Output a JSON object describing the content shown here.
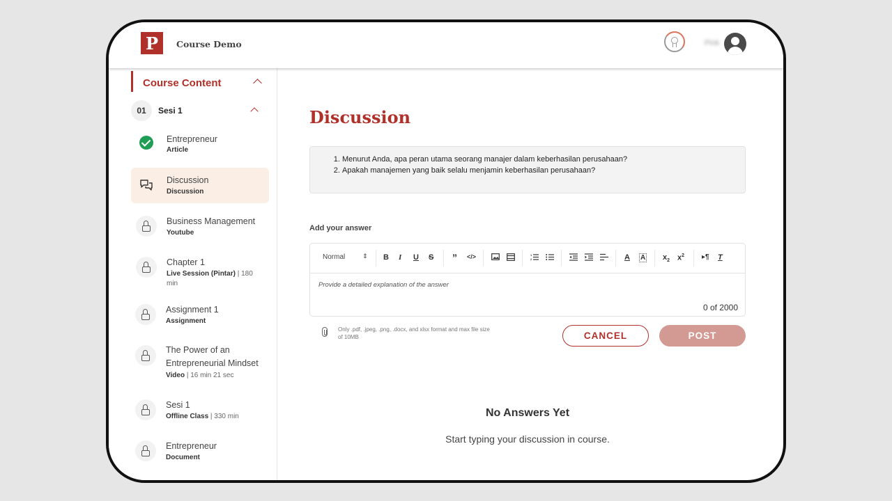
{
  "header": {
    "logo_text": "P",
    "app_title": "Course Demo",
    "username": "Pink"
  },
  "sidebar": {
    "section_title": "Course Content",
    "session": {
      "number": "01",
      "name": "Sesi 1"
    },
    "items": [
      {
        "title": "Entrepreneur",
        "type": "Article",
        "extra": ""
      },
      {
        "title": "Discussion",
        "type": "Discussion",
        "extra": ""
      },
      {
        "title": "Business Management",
        "type": "Youtube",
        "extra": ""
      },
      {
        "title": "Chapter 1",
        "type": "Live Session (Pintar)",
        "extra": " | 180 min"
      },
      {
        "title": "Assignment 1",
        "type": "Assignment",
        "extra": ""
      },
      {
        "title": "The Power of an Entrepreneurial Mindset",
        "type": "Video",
        "extra": " | 16 min 21 sec"
      },
      {
        "title": "Sesi 1",
        "type": "Offline Class",
        "extra": " | 330 min"
      },
      {
        "title": "Entrepreneur",
        "type": "Document",
        "extra": ""
      }
    ]
  },
  "main": {
    "title": "Discussion",
    "questions": [
      "Menurut Anda, apa peran utama seorang manajer dalam keberhasilan perusahaan?",
      "Apakah manajemen yang baik selalu menjamin keberhasilan perusahaan?"
    ],
    "answer_label": "Add your answer",
    "editor": {
      "format_select": "Normal",
      "placeholder": "Provide a detailed explanation of the answer",
      "counter": "0  of  2000"
    },
    "file_hint": "Only .pdf, .jpeg, .png, .docx, and xlsx format and max file size of 10MB",
    "cancel_label": "CANCEL",
    "post_label": "POST",
    "empty_title": "No Answers Yet",
    "empty_subtitle": "Start typing your discussion in course."
  },
  "colors": {
    "brand": "#b0302a",
    "post_button": "#d39a93",
    "active_item_bg": "#fbeee4",
    "complete": "#1f9d55"
  }
}
